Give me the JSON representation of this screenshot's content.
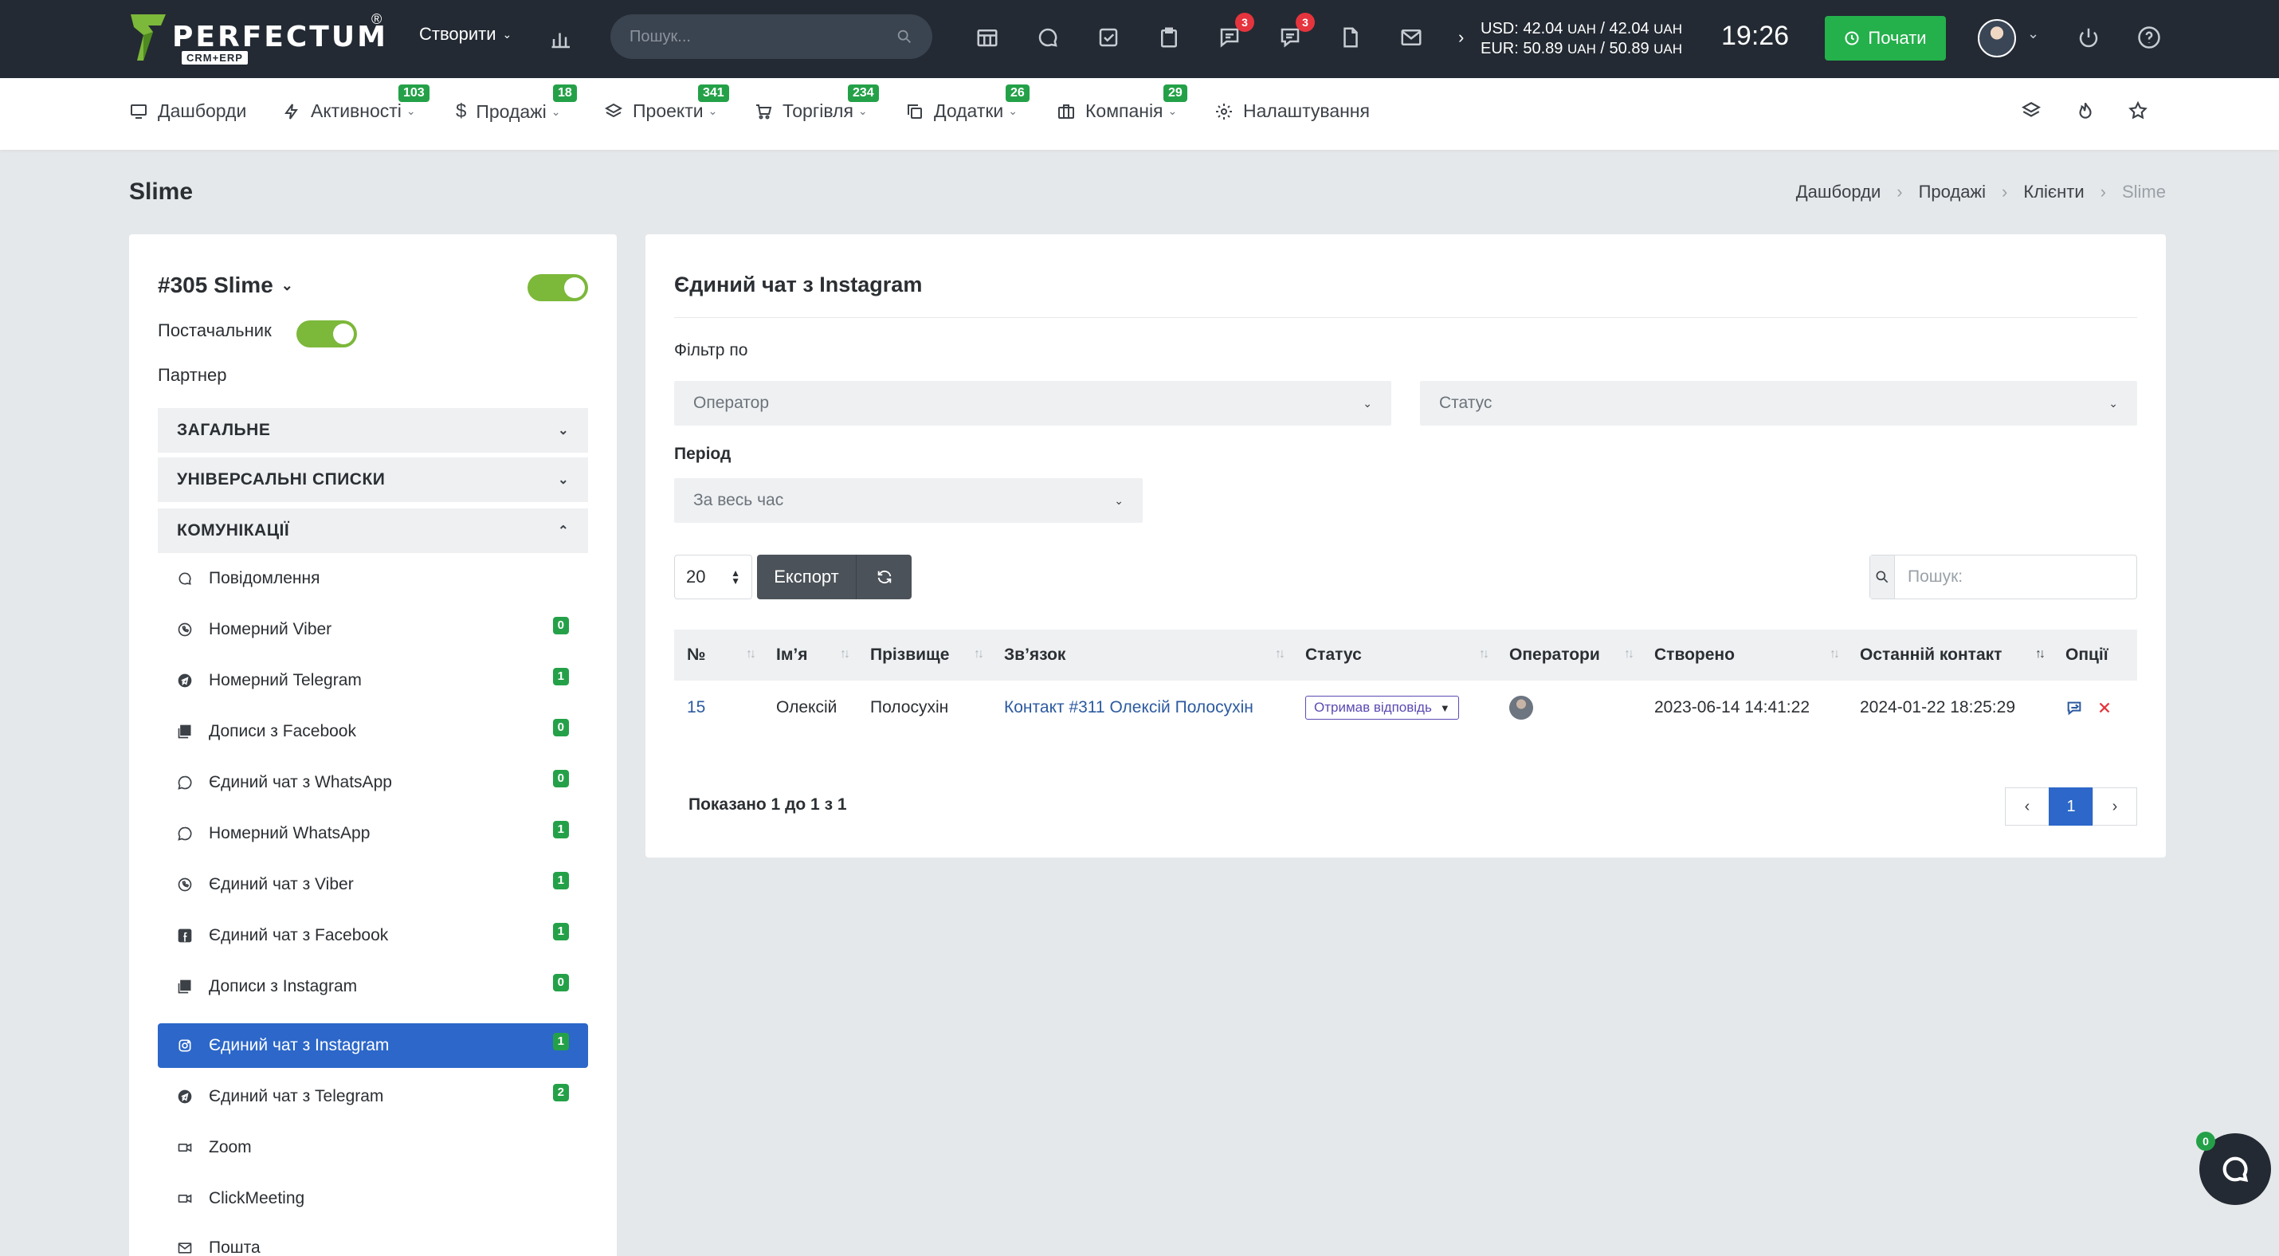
{
  "logo": {
    "name": "PERFECTUM",
    "sub": "CRM+ERP",
    "reg": "®"
  },
  "header": {
    "create_label": "Створити",
    "search_placeholder": "Пошук...",
    "badges": {
      "chat1": "3",
      "chat2": "3"
    },
    "currency_usd": "USD: 42.04",
    "currency_usd_unit1": "UAH",
    "currency_usd_mid": "/ 42.04",
    "currency_usd_unit2": "UAH",
    "currency_eur": "EUR: 50.89",
    "currency_eur_unit1": "UAH",
    "currency_eur_mid": "/ 50.89",
    "currency_eur_unit2": "UAH",
    "clock": "19:26",
    "start_label": "Почати"
  },
  "nav": {
    "items": [
      {
        "label": "Дашборди",
        "badge": ""
      },
      {
        "label": "Активності",
        "badge": "103"
      },
      {
        "label": "Продажі",
        "badge": "18"
      },
      {
        "label": "Проекти",
        "badge": "341"
      },
      {
        "label": "Торгівля",
        "badge": "234"
      },
      {
        "label": "Додатки",
        "badge": "26"
      },
      {
        "label": "Компанія",
        "badge": "29"
      },
      {
        "label": "Налаштування",
        "badge": ""
      }
    ]
  },
  "page": {
    "title": "Slime",
    "breadcrumb": [
      "Дашборди",
      "Продажі",
      "Клієнти",
      "Slime"
    ]
  },
  "client": {
    "name": "#305 Slime",
    "supplier_label": "Постачальник",
    "partner_label": "Партнер",
    "sections": [
      "ЗАГАЛЬНЕ",
      "УНІВЕРСАЛЬНІ СПИСКИ",
      "КОМУНІКАЦІЇ"
    ],
    "comm_items": [
      {
        "label": "Повідомлення",
        "count": ""
      },
      {
        "label": "Номерний Viber",
        "count": "0"
      },
      {
        "label": "Номерний Telegram",
        "count": "1"
      },
      {
        "label": "Дописи з Facebook",
        "count": "0"
      },
      {
        "label": "Єдиний чат з WhatsApp",
        "count": "0"
      },
      {
        "label": "Номерний WhatsApp",
        "count": "1"
      },
      {
        "label": "Єдиний чат з Viber",
        "count": "1"
      },
      {
        "label": "Єдиний чат з Facebook",
        "count": "1"
      },
      {
        "label": "Дописи з Instagram",
        "count": "0"
      },
      {
        "label": "Єдиний чат з Instagram",
        "count": "1"
      },
      {
        "label": "Єдиний чат з Telegram",
        "count": "2"
      },
      {
        "label": "Zoom",
        "count": ""
      },
      {
        "label": "ClickMeeting",
        "count": ""
      },
      {
        "label": "Пошта",
        "count": ""
      }
    ]
  },
  "main": {
    "title": "Єдиний чат з Instagram",
    "filter_label": "Фільтр по",
    "operator_placeholder": "Оператор",
    "status_placeholder": "Статус",
    "period_label": "Період",
    "period_value": "За весь час",
    "page_length": "20",
    "export_label": "Експорт",
    "search_placeholder": "Пошук:",
    "columns": [
      "№",
      "Ім’я",
      "Прізвище",
      "Зв’язок",
      "Статус",
      "Оператори",
      "Створено",
      "Останній контакт",
      "Опції"
    ],
    "rows": [
      {
        "num": "15",
        "first": "Олексій",
        "last": "Полосухін",
        "link": "Контакт #311 Олексій Полосухін",
        "status": "Отримав відповідь",
        "created": "2023-06-14 14:41:22",
        "last_contact": "2024-01-22 18:25:29"
      }
    ],
    "info": "Показано 1 до 1 з 1",
    "current_page": "1"
  },
  "chat_fab": {
    "badge": "0"
  }
}
